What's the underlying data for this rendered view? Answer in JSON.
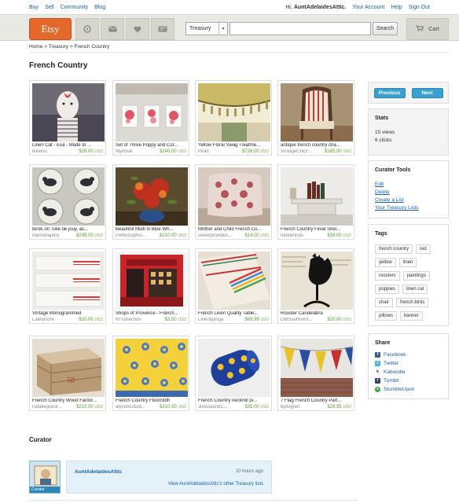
{
  "topnav": {
    "left": [
      "Buy",
      "Sell",
      "Community",
      "Blog"
    ],
    "greeting_prefix": "Hi,",
    "username": "AuntAdelaidesAttic.",
    "right": [
      "Your Account",
      "Help",
      "Sign Out"
    ]
  },
  "header": {
    "logo": "Etsy",
    "search_scope": "Treasury",
    "search_value": "",
    "search_button": "Search",
    "cart_label": "Cart"
  },
  "breadcrumb": "Home > Treasury > French Country",
  "page_title": "French Country",
  "items": [
    {
      "title": "Linen Cat - Eva - Made to ...",
      "shop": "leilalou",
      "price": "$26.00",
      "currency": "USD"
    },
    {
      "title": "Set of Three Poppy and Cor...",
      "shop": "lillydove",
      "price": "$240.00",
      "currency": "USD"
    },
    {
      "title": "Yellow Floral Swag Treatme...",
      "shop": "lrtrad",
      "price": "$726.00",
      "currency": "USD"
    },
    {
      "title": "antique french country cha...",
      "shop": "VintageChicF...",
      "price": "$185.00",
      "currency": "USD"
    },
    {
      "title": "Birds on Toile de jouy, as...",
      "shop": "manuelajarry",
      "price": "$295.00",
      "currency": "USD"
    },
    {
      "title": "Beautiful Multi in Blue Wh...",
      "shop": "PetiteSophis...",
      "price": "$210.00",
      "currency": "USD"
    },
    {
      "title": "Mother and Child French Co...",
      "shop": "sweetdovedes...",
      "price": "$14.00",
      "currency": "USD"
    },
    {
      "title": "French Country Finial Shel...",
      "shop": "funklefinds",
      "price": "$39.00",
      "currency": "USD"
    },
    {
      "title": "Vintage Monogrammed",
      "shop": "LaManche",
      "price": "$20.00",
      "currency": "USD"
    },
    {
      "title": "Shops of Provence - French...",
      "shop": "KFcollection",
      "price": "$3.50",
      "currency": "USD"
    },
    {
      "title": "French Linen Quality Table...",
      "shop": "Linenbylnga",
      "price": "$69.99",
      "currency": "USD"
    },
    {
      "title": "Rooster Candelabra",
      "shop": "OldSouthVint...",
      "price": "$20.00",
      "currency": "USD"
    },
    {
      "title": "French Country Wood Factor...",
      "shop": "nataliegrace...",
      "price": "$210.00",
      "currency": "USD"
    },
    {
      "title": "French Country Floorcloth",
      "shop": "alysoncstudi...",
      "price": "$210.00",
      "currency": "USD"
    },
    {
      "title": "French Country neckroll pi...",
      "shop": "JulissaandC...",
      "price": "$35.00",
      "currency": "USD"
    },
    {
      "title": "7 Flag French Country Part...",
      "shop": "bjstvgren",
      "price": "$29.95",
      "currency": "USD"
    }
  ],
  "pager": {
    "previous": "Previous",
    "next": "Next"
  },
  "stats": {
    "heading": "Stats",
    "views": "15 views",
    "clicks": "6 clicks"
  },
  "curator_tools": {
    "heading": "Curator Tools",
    "links": [
      "Edit",
      "Delete",
      "Create a List",
      "Your Treasury Lists"
    ]
  },
  "tags": {
    "heading": "Tags",
    "list": [
      "french country",
      "red",
      "yellow",
      "linen",
      "roosters",
      "paintings",
      "poppies",
      "linen cat",
      "chair",
      "french birds",
      "pillows",
      "banner"
    ]
  },
  "share": {
    "heading": "Share",
    "links": [
      "Facebook",
      "Twitter",
      "Kaboodle",
      "Tumblr",
      "StumbleUpon"
    ]
  },
  "curator": {
    "heading": "Curator",
    "avatar_label": "Curator",
    "name": "AuntAdelaidesAttic",
    "time": "10 hours ago",
    "link": "View AuntAdelaidesAttic's other Treasury lists"
  },
  "colors": {
    "etsy_orange": "#e2682c",
    "link_blue": "#1a5fa8",
    "price_green": "#5a9a2a",
    "pager_blue": "#3aa0cf"
  },
  "icons": [
    "clock-icon",
    "mail-icon",
    "heart-icon",
    "image-icon",
    "cart-icon"
  ]
}
